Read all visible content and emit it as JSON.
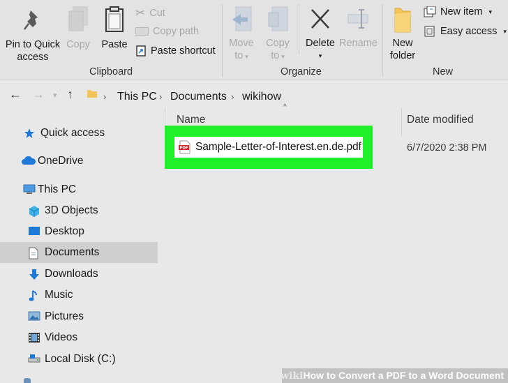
{
  "ribbon": {
    "clipboard": {
      "pin_label_1": "Pin to Quick",
      "pin_label_2": "access",
      "copy_label": "Copy",
      "paste_label": "Paste",
      "cut_label": "Cut",
      "copy_path_label": "Copy path",
      "paste_shortcut_label": "Paste shortcut",
      "group_label": "Clipboard"
    },
    "organize": {
      "move_to_1": "Move",
      "move_to_2": "to",
      "copy_to_1": "Copy",
      "copy_to_2": "to",
      "delete_label": "Delete",
      "rename_label": "Rename",
      "group_label": "Organize"
    },
    "new": {
      "new_folder_1": "New",
      "new_folder_2": "folder",
      "new_item_label": "New item",
      "easy_access_label": "Easy access",
      "group_label": "New"
    }
  },
  "address": {
    "crumbs": [
      "This PC",
      "Documents",
      "wikihow"
    ]
  },
  "nav_pane": {
    "items": [
      {
        "label": "Quick access",
        "icon": "star-icon"
      },
      {
        "label": "OneDrive",
        "icon": "cloud-icon"
      },
      {
        "label": "This PC",
        "icon": "computer-icon"
      },
      {
        "label": "3D Objects",
        "icon": "cube-icon"
      },
      {
        "label": "Desktop",
        "icon": "desktop-icon"
      },
      {
        "label": "Documents",
        "icon": "document-icon"
      },
      {
        "label": "Downloads",
        "icon": "download-icon"
      },
      {
        "label": "Music",
        "icon": "music-icon"
      },
      {
        "label": "Pictures",
        "icon": "picture-icon"
      },
      {
        "label": "Videos",
        "icon": "video-icon"
      },
      {
        "label": "Local Disk (C:)",
        "icon": "disk-icon"
      }
    ]
  },
  "file_list": {
    "headers": {
      "name": "Name",
      "date": "Date modified"
    },
    "files": [
      {
        "name": "Sample-Letter-of-Interest.en.de.pdf",
        "date": "6/7/2020 2:38 PM",
        "icon": "pdf-icon",
        "icon_text": "PDF"
      }
    ]
  },
  "watermark": {
    "logo": "wiki",
    "text_bold": "How",
    "text_rest": " to Convert a PDF to a Word Document"
  },
  "colors": {
    "highlight": "#1ff02a",
    "folder": "#f2c45a",
    "accent_blue": "#1e7ad6",
    "pdf_red": "#d22a2a"
  }
}
